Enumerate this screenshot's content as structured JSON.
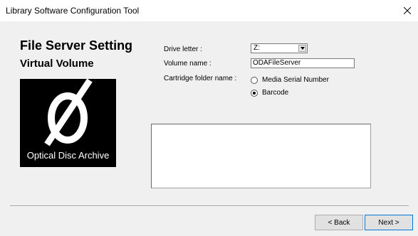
{
  "window": {
    "title": "Library Software Configuration Tool",
    "close_icon": "close-icon"
  },
  "page": {
    "heading": "File Server Setting",
    "subheading": "Virtual Volume",
    "logo_text": "Optical Disc Archive"
  },
  "form": {
    "drive_letter_label": "Drive letter :",
    "drive_letter_value": "Z:",
    "volume_name_label": "Volume name :",
    "volume_name_value": "ODAFileServer",
    "cartridge_folder_label": "Cartridge folder name :",
    "options": [
      {
        "label": "Media Serial Number",
        "checked": false
      },
      {
        "label": "Barcode",
        "checked": true
      }
    ]
  },
  "footer": {
    "back_label": "< Back",
    "next_label": "Next >"
  }
}
